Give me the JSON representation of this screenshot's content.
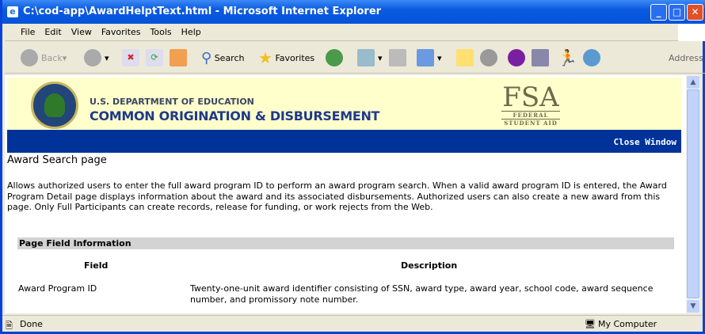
{
  "window": {
    "title": "C:\\cod-app\\AwardHelptText.html - Microsoft Internet Explorer"
  },
  "menu": [
    "File",
    "Edit",
    "View",
    "Favorites",
    "Tools",
    "Help"
  ],
  "toolbar": {
    "back": "Back",
    "search": "Search",
    "favorites": "Favorites",
    "address": "Address"
  },
  "banner": {
    "dept": "U.S. DEPARTMENT OF EDUCATION",
    "program": "COMMON ORIGINATION & DISBURSEMENT",
    "fsa": "FSA",
    "fsa_sub1": "FEDERAL",
    "fsa_sub2": "STUDENT AID",
    "close": "Close Window"
  },
  "page": {
    "heading": "Award Search page",
    "description": "Allows authorized users to enter the full award program ID to perform an award program search. When a valid award program ID is entered, the Award Program Detail page displays information about the award and its associated disbursements. Authorized users can also create a new award from this page. Only Full Participants can create records, release for funding, or work rejects from the Web.",
    "section": "Page Field Information",
    "columns": [
      "Field",
      "Description"
    ],
    "rows": [
      {
        "field": "Award Program ID",
        "description": "Twenty-one-unit award identifier consisting of SSN, award type, award year, school code, award sequence number, and promissory note number."
      }
    ]
  },
  "status": {
    "left": "Done",
    "right": "My Computer"
  }
}
